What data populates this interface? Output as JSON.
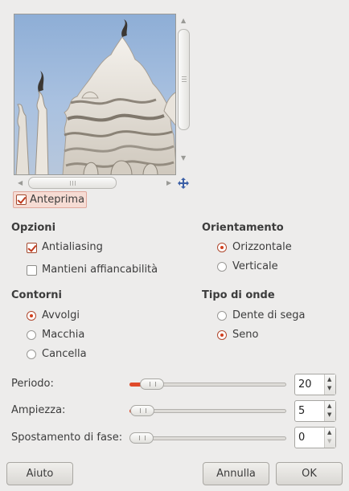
{
  "preview": {
    "toggle_label": "Anteprima",
    "toggle_checked": true,
    "image_alt_icon": "distorted-building-preview"
  },
  "opzioni": {
    "heading": "Opzioni",
    "antialiasing": {
      "label": "Antialiasing",
      "checked": true
    },
    "mantieni": {
      "label": "Mantieni affiancabilità",
      "checked": false
    }
  },
  "orientamento": {
    "heading": "Orientamento",
    "options": [
      {
        "label": "Orizzontale",
        "selected": true
      },
      {
        "label": "Verticale",
        "selected": false
      }
    ]
  },
  "contorni": {
    "heading": "Contorni",
    "options": [
      {
        "label": "Avvolgi",
        "selected": true
      },
      {
        "label": "Macchia",
        "selected": false
      },
      {
        "label": "Cancella",
        "selected": false
      }
    ]
  },
  "tipo_onde": {
    "heading": "Tipo di onde",
    "options": [
      {
        "label": "Dente di sega",
        "selected": false
      },
      {
        "label": "Seno",
        "selected": true
      }
    ]
  },
  "sliders": [
    {
      "label": "Periodo:",
      "value": "20"
    },
    {
      "label": "Ampiezza:",
      "value": "5"
    },
    {
      "label": "Spostamento di fase:",
      "value": "0"
    }
  ],
  "buttons": {
    "help": "Aiuto",
    "cancel": "Annulla",
    "ok": "OK"
  },
  "colors": {
    "accent": "#e04a2a",
    "background": "#edeceb"
  }
}
